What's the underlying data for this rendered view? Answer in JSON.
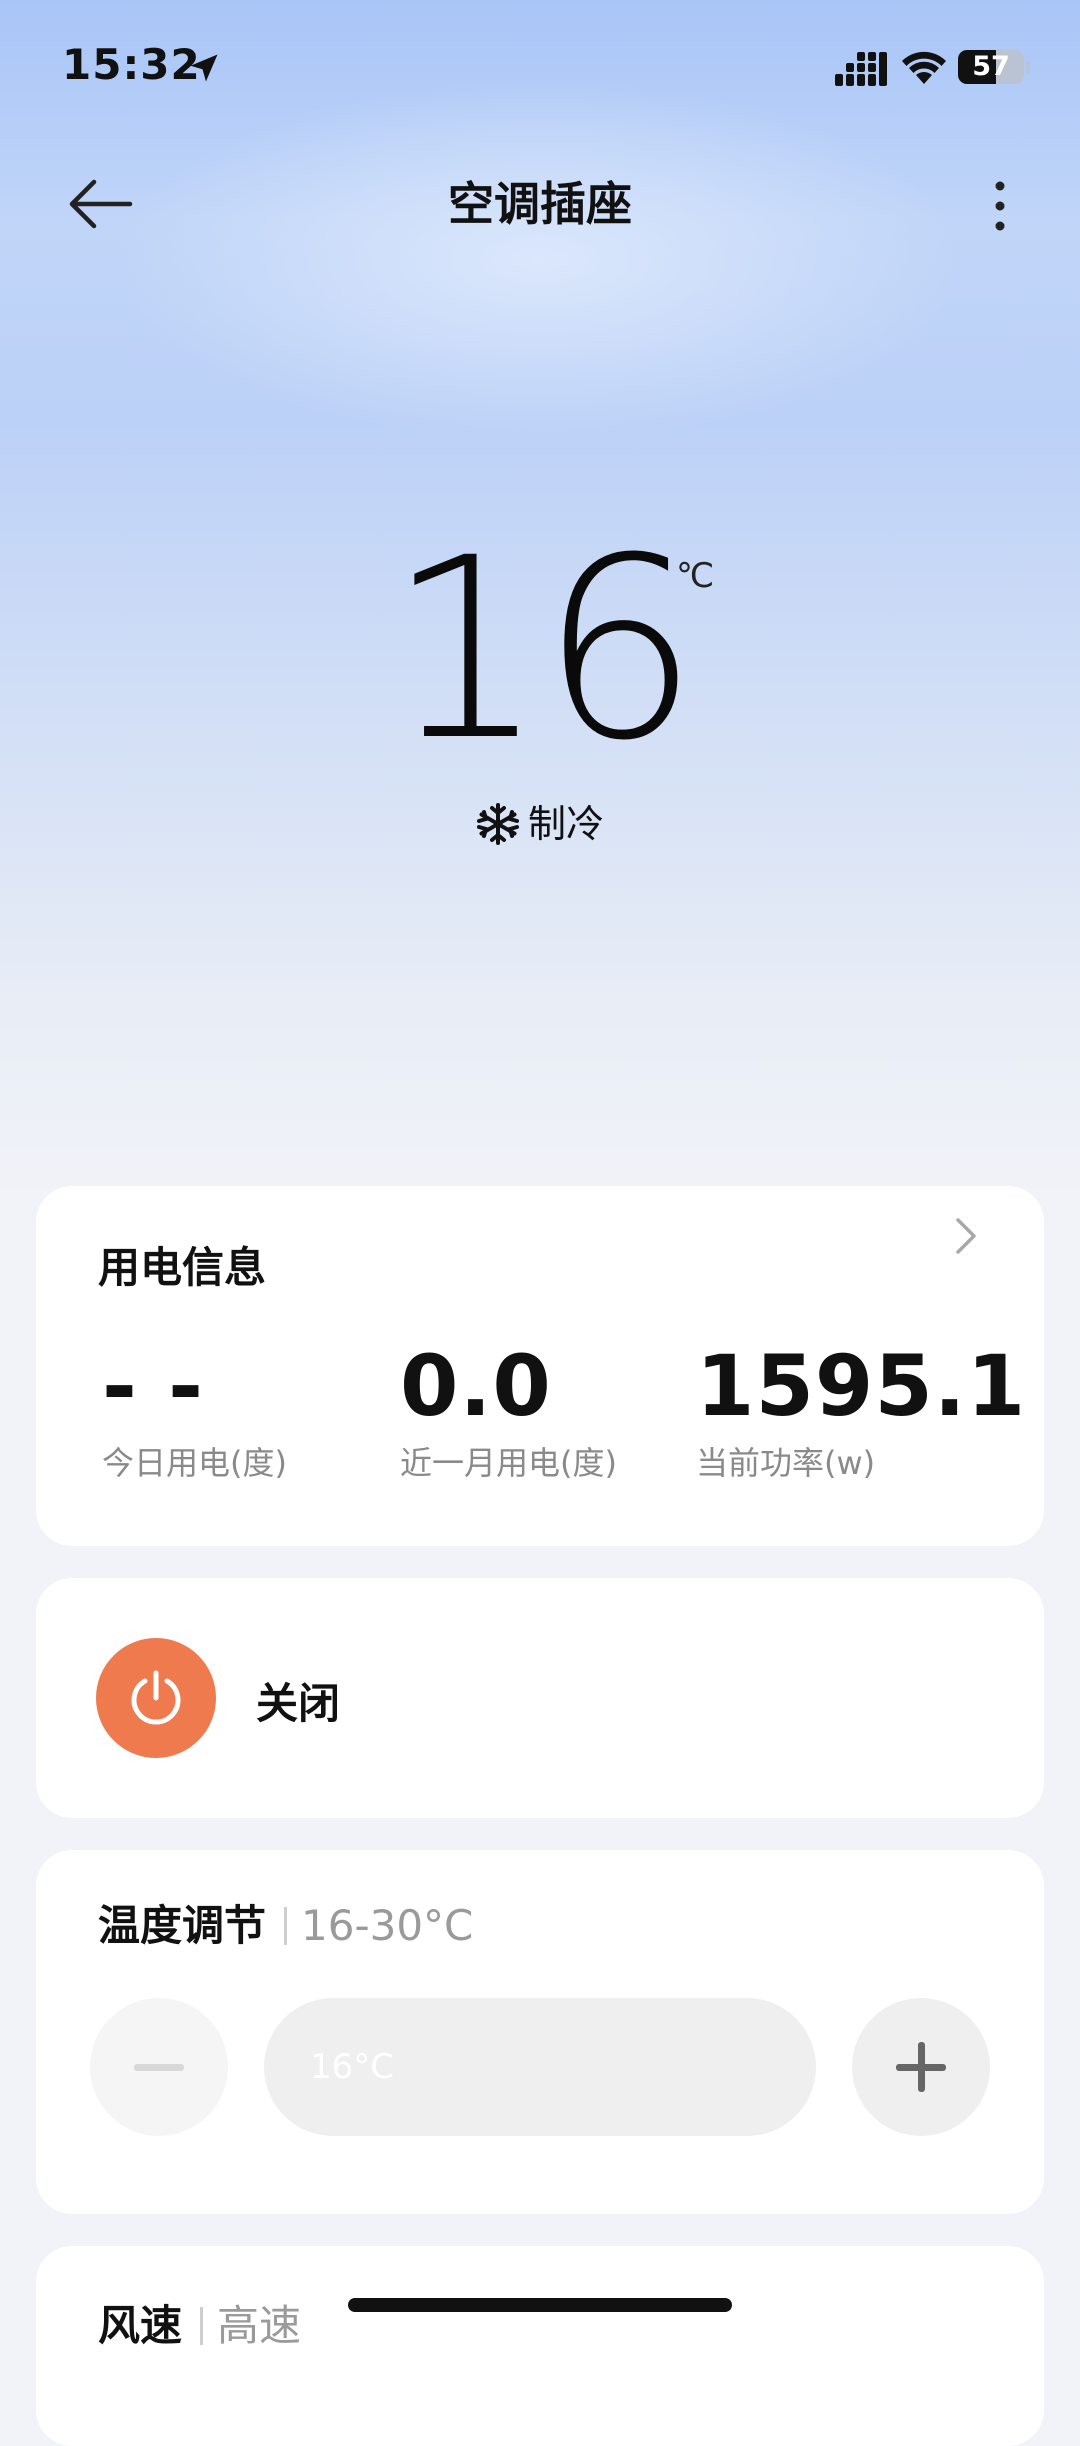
{
  "status_bar": {
    "time": "15:32",
    "battery_text": "57",
    "battery_level": 0.57
  },
  "header": {
    "title": "空调插座"
  },
  "hero": {
    "temperature": "16",
    "unit": "℃",
    "mode_label": "制冷"
  },
  "energy": {
    "title": "用电信息",
    "stats": [
      {
        "value": "- -",
        "label": "今日用电(度)"
      },
      {
        "value": "0.0",
        "label": "近一月用电(度)"
      },
      {
        "value": "1595.1",
        "label": "当前功率(w)"
      }
    ]
  },
  "power": {
    "label": "关闭",
    "color": "#ee7a4e"
  },
  "temp_control": {
    "title": "温度调节",
    "range": "16-30°C",
    "current": "16°C"
  },
  "fan": {
    "title": "风速",
    "value": "高速"
  }
}
